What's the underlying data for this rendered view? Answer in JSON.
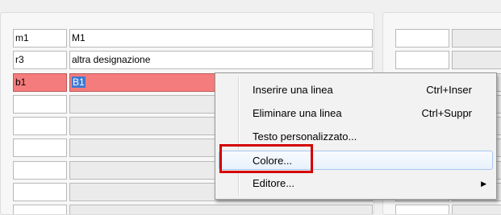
{
  "table": {
    "rows": [
      {
        "code": "m1",
        "description": "M1"
      },
      {
        "code": "r3",
        "description": "altra designazione"
      },
      {
        "code": "b1",
        "description": "B1"
      },
      {
        "code": "",
        "description": ""
      },
      {
        "code": "",
        "description": ""
      },
      {
        "code": "",
        "description": ""
      },
      {
        "code": "",
        "description": ""
      },
      {
        "code": "",
        "description": ""
      },
      {
        "code": "",
        "description": ""
      }
    ]
  },
  "context_menu": {
    "items": [
      {
        "label": "Inserire una linea",
        "shortcut": "Ctrl+Inser"
      },
      {
        "label": "Eliminare una linea",
        "shortcut": "Ctrl+Suppr"
      },
      {
        "label": "Testo personalizzato...",
        "shortcut": ""
      },
      {
        "label": "Colore...",
        "shortcut": ""
      },
      {
        "label": "Editore...",
        "shortcut": ""
      }
    ],
    "submenu_arrow": "▶"
  },
  "colors": {
    "selected_row": "#f57c7c",
    "text_selection": "#3f79d2",
    "annotation_box": "#d40000"
  }
}
